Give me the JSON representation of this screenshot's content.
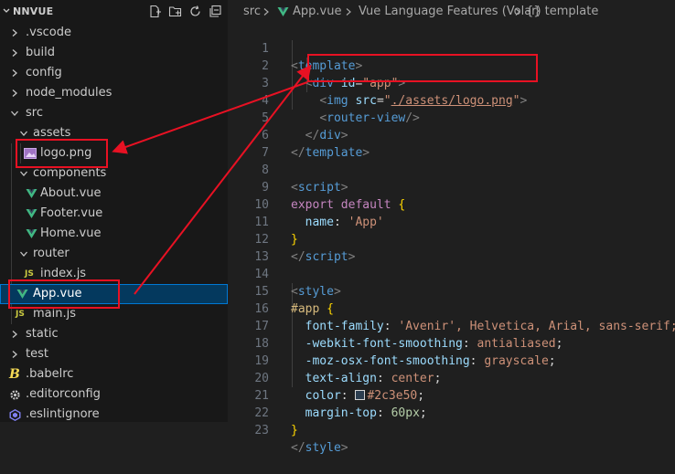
{
  "explorer": {
    "title": "NNVUE",
    "items": [
      {
        "label": ".vscode",
        "kind": "folder",
        "open": false
      },
      {
        "label": "build",
        "kind": "folder",
        "open": false
      },
      {
        "label": "config",
        "kind": "folder",
        "open": false
      },
      {
        "label": "node_modules",
        "kind": "folder",
        "open": false
      },
      {
        "label": "src",
        "kind": "folder",
        "open": true
      },
      {
        "label": "assets",
        "kind": "folder",
        "open": true
      },
      {
        "label": "logo.png",
        "kind": "image"
      },
      {
        "label": "components",
        "kind": "folder",
        "open": true
      },
      {
        "label": "About.vue",
        "kind": "vue"
      },
      {
        "label": "Footer.vue",
        "kind": "vue"
      },
      {
        "label": "Home.vue",
        "kind": "vue"
      },
      {
        "label": "router",
        "kind": "folder",
        "open": true
      },
      {
        "label": "index.js",
        "kind": "js"
      },
      {
        "label": "App.vue",
        "kind": "vue",
        "selected": true
      },
      {
        "label": "main.js",
        "kind": "js"
      },
      {
        "label": "static",
        "kind": "folder",
        "open": false
      },
      {
        "label": "test",
        "kind": "folder",
        "open": false
      },
      {
        "label": ".babelrc",
        "kind": "babel"
      },
      {
        "label": ".editorconfig",
        "kind": "gear"
      },
      {
        "label": ".eslintignore",
        "kind": "eslint"
      }
    ],
    "icon_names": [
      "new-file-icon",
      "new-folder-icon",
      "refresh-icon",
      "collapse-all-icon"
    ]
  },
  "breadcrumb": {
    "part1": "src",
    "part2": "App.vue",
    "part3": "Vue Language Features (Volar)",
    "part4": "{} template"
  },
  "code": {
    "line_numbers": [
      "1",
      "2",
      "3",
      "4",
      "5",
      "6",
      "7",
      "8",
      "9",
      "10",
      "11",
      "12",
      "13",
      "14",
      "15",
      "16",
      "17",
      "18",
      "19",
      "20",
      "21",
      "22",
      "23"
    ],
    "l2_attr": "id",
    "l2_value": "\"app\"",
    "l3_attr": "src",
    "l3_value_q": "\"",
    "l3_value": "./assets/logo.png",
    "l4_tag": "router-view",
    "l9_kw": "export default",
    "l10_key": "name",
    "l10_value": "'App'",
    "l15_selector": "#app",
    "l16_prop": "font-family",
    "l16_value": "'Avenir', Helvetica, Arial, sans-serif;",
    "l17_prop": "-webkit-font-smoothing",
    "l17_value": "antialiased",
    "l18_prop": "-moz-osx-font-smoothing",
    "l18_value": "grayscale",
    "l19_prop": "text-align",
    "l19_value": "center",
    "l20_prop": "color",
    "l20_value": "#2c3e50",
    "l21_prop": "margin-top",
    "l21_value": "60px",
    "tag_template": "template",
    "tag_div": "div",
    "tag_img": "img",
    "tag_script": "script",
    "tag_style": "style"
  },
  "colors": {
    "annotation_red": "#e81123",
    "selection_bg": "#04395e",
    "vue_green": "#41b883",
    "js_yellow": "#cbcb41"
  }
}
